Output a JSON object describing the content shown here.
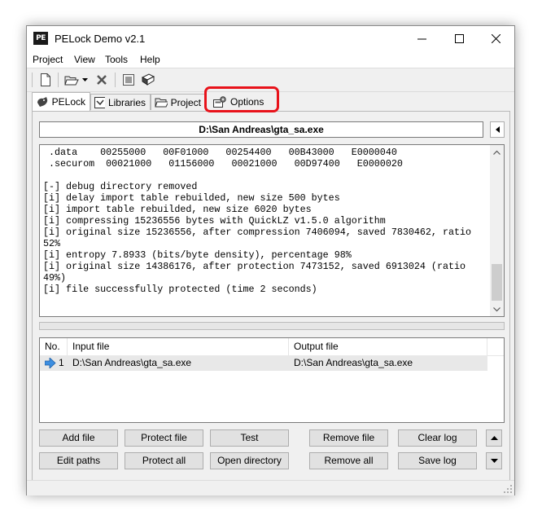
{
  "window": {
    "title": "PELock Demo v2.1",
    "app_icon_text": "PE"
  },
  "menu": {
    "items": [
      "Project",
      "View",
      "Tools",
      "Help"
    ]
  },
  "toolbar": {
    "icons": [
      "new-document-icon",
      "open-folder-icon",
      "dropdown-arrow-icon",
      "delete-icon",
      "protect-icon",
      "book-icon"
    ]
  },
  "tabs": [
    {
      "label": "PELock",
      "icon": "pelock-icon"
    },
    {
      "label": "Libraries",
      "icon": "libraries-icon"
    },
    {
      "label": "Project",
      "icon": "project-icon"
    },
    {
      "label": "Options",
      "icon": "options-icon"
    }
  ],
  "active_tab": "PELock",
  "highlighted_tab": "Options",
  "accent_color": "#e8121a",
  "path": {
    "value": "D:\\San Andreas\\gta_sa.exe"
  },
  "log": {
    "lines": [
      " .data    00255000   00F01000   00254400   00B43000   E0000040",
      " .securom  00021000   01156000   00021000   00D97400   E0000020",
      "",
      "[-] debug directory removed",
      "[i] delay import table rebuilded, new size 500 bytes",
      "[i] import table rebuilded, new size 6020 bytes",
      "[i] compressing 15236556 bytes with QuickLZ v1.5.0 algorithm",
      "[i] original size 15236556, after compression 7406094, saved 7830462, ratio",
      "52%",
      "[i] entropy 7.8933 (bits/byte density), percentage 98%",
      "[i] original size 14386176, after protection 7473152, saved 6913024 (ratio",
      "49%)",
      "[i] file successfully protected (time 2 seconds)"
    ]
  },
  "file_list": {
    "columns": [
      "No.",
      "Input file",
      "Output file"
    ],
    "rows": [
      {
        "no": "1",
        "input": "D:\\San Andreas\\gta_sa.exe",
        "output": "D:\\San Andreas\\gta_sa.exe"
      }
    ]
  },
  "buttons": {
    "add_file": "Add file",
    "protect_file": "Protect file",
    "test": "Test",
    "remove_file": "Remove file",
    "clear_log": "Clear log",
    "edit_paths": "Edit paths",
    "protect_all": "Protect all",
    "open_directory": "Open directory",
    "remove_all": "Remove all",
    "save_log": "Save log"
  }
}
